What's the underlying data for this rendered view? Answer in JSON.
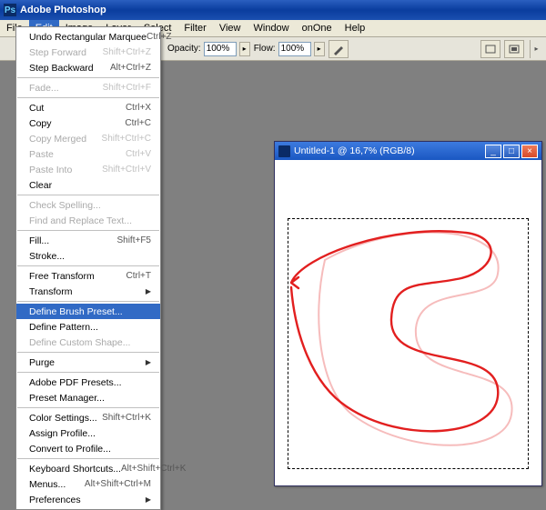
{
  "title": "Adobe Photoshop",
  "menubar": [
    "File",
    "Edit",
    "Image",
    "Layer",
    "Select",
    "Filter",
    "View",
    "Window",
    "onOne",
    "Help"
  ],
  "open_menu_index": 1,
  "optionbar": {
    "opacity_label": "Opacity:",
    "opacity_value": "100%",
    "flow_label": "Flow:",
    "flow_value": "100%"
  },
  "edit_menu": [
    {
      "t": "item",
      "label": "Undo Rectangular Marquee",
      "shortcut": "Ctrl+Z"
    },
    {
      "t": "item",
      "label": "Step Forward",
      "shortcut": "Shift+Ctrl+Z",
      "disabled": true
    },
    {
      "t": "item",
      "label": "Step Backward",
      "shortcut": "Alt+Ctrl+Z"
    },
    {
      "t": "sep"
    },
    {
      "t": "item",
      "label": "Fade...",
      "shortcut": "Shift+Ctrl+F",
      "disabled": true
    },
    {
      "t": "sep"
    },
    {
      "t": "item",
      "label": "Cut",
      "shortcut": "Ctrl+X"
    },
    {
      "t": "item",
      "label": "Copy",
      "shortcut": "Ctrl+C"
    },
    {
      "t": "item",
      "label": "Copy Merged",
      "shortcut": "Shift+Ctrl+C",
      "disabled": true
    },
    {
      "t": "item",
      "label": "Paste",
      "shortcut": "Ctrl+V",
      "disabled": true
    },
    {
      "t": "item",
      "label": "Paste Into",
      "shortcut": "Shift+Ctrl+V",
      "disabled": true
    },
    {
      "t": "item",
      "label": "Clear",
      "shortcut": ""
    },
    {
      "t": "sep"
    },
    {
      "t": "item",
      "label": "Check Spelling...",
      "shortcut": "",
      "disabled": true
    },
    {
      "t": "item",
      "label": "Find and Replace Text...",
      "shortcut": "",
      "disabled": true
    },
    {
      "t": "sep"
    },
    {
      "t": "item",
      "label": "Fill...",
      "shortcut": "Shift+F5"
    },
    {
      "t": "item",
      "label": "Stroke...",
      "shortcut": ""
    },
    {
      "t": "sep"
    },
    {
      "t": "item",
      "label": "Free Transform",
      "shortcut": "Ctrl+T"
    },
    {
      "t": "sub",
      "label": "Transform"
    },
    {
      "t": "sep"
    },
    {
      "t": "item",
      "label": "Define Brush Preset...",
      "shortcut": "",
      "highlight": true
    },
    {
      "t": "item",
      "label": "Define Pattern...",
      "shortcut": ""
    },
    {
      "t": "item",
      "label": "Define Custom Shape...",
      "shortcut": "",
      "disabled": true
    },
    {
      "t": "sep"
    },
    {
      "t": "sub",
      "label": "Purge"
    },
    {
      "t": "sep"
    },
    {
      "t": "item",
      "label": "Adobe PDF Presets...",
      "shortcut": ""
    },
    {
      "t": "item",
      "label": "Preset Manager...",
      "shortcut": ""
    },
    {
      "t": "sep"
    },
    {
      "t": "item",
      "label": "Color Settings...",
      "shortcut": "Shift+Ctrl+K"
    },
    {
      "t": "item",
      "label": "Assign Profile...",
      "shortcut": ""
    },
    {
      "t": "item",
      "label": "Convert to Profile...",
      "shortcut": ""
    },
    {
      "t": "sep"
    },
    {
      "t": "item",
      "label": "Keyboard Shortcuts...",
      "shortcut": "Alt+Shift+Ctrl+K"
    },
    {
      "t": "item",
      "label": "Menus...",
      "shortcut": "Alt+Shift+Ctrl+M"
    },
    {
      "t": "sub",
      "label": "Preferences"
    }
  ],
  "document": {
    "title": "Untitled-1 @ 16,7% (RGB/8)"
  }
}
